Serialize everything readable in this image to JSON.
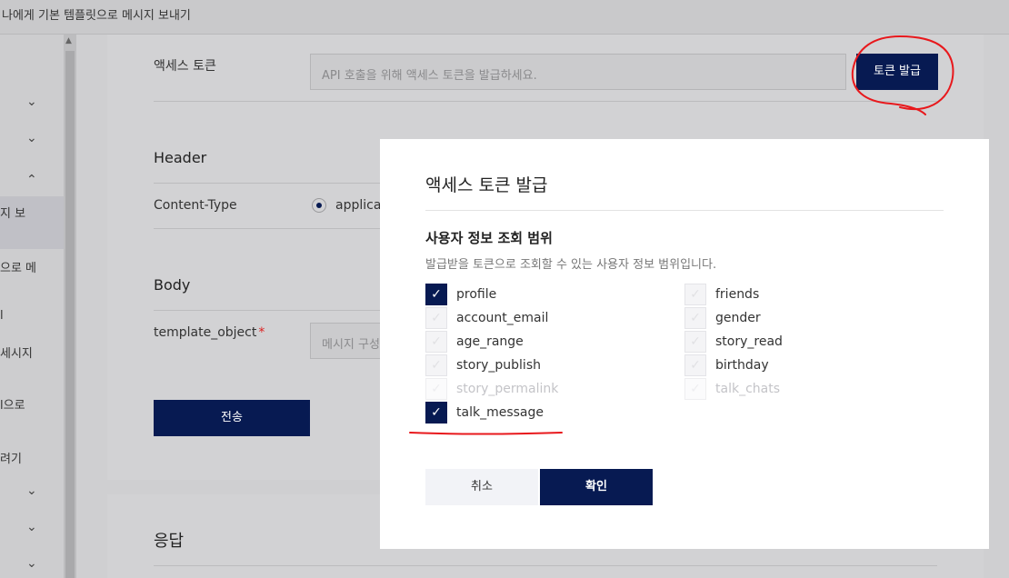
{
  "topbar": {
    "title": "나에게 기본 템플릿으로 메시지 보내기"
  },
  "sidebar": {
    "items": [
      {
        "label": "지 보"
      },
      {
        "label": "으로 메"
      },
      {
        "label": "l"
      },
      {
        "label": "세시지"
      },
      {
        "label": "l으로"
      },
      {
        "label": "려기"
      }
    ]
  },
  "form": {
    "access_token_label": "액세스 토큰",
    "access_token_placeholder": "API 호출을 위해 액세스 토큰을 발급하세요.",
    "issue_token_button": "토큰 발급",
    "header_section": "Header",
    "content_type_label": "Content-Type",
    "content_type_value": "applicat",
    "body_section": "Body",
    "template_object_label": "template_object",
    "required_mark": "*",
    "template_object_placeholder": "메시지 구성",
    "send_button": "전송",
    "response_section": "응답"
  },
  "modal": {
    "title": "액세스 토큰 발급",
    "scope_title": "사용자 정보 조회 범위",
    "scope_desc": "발급받을 토큰으로 조회할 수 있는 사용자 정보 범위입니다.",
    "scopes_left": [
      {
        "label": "profile",
        "checked": true,
        "disabled": false
      },
      {
        "label": "account_email",
        "checked": false,
        "disabled": false
      },
      {
        "label": "age_range",
        "checked": false,
        "disabled": false
      },
      {
        "label": "story_publish",
        "checked": false,
        "disabled": false
      },
      {
        "label": "story_permalink",
        "checked": false,
        "disabled": true
      },
      {
        "label": "talk_message",
        "checked": true,
        "disabled": false
      }
    ],
    "scopes_right": [
      {
        "label": "friends",
        "checked": false,
        "disabled": false
      },
      {
        "label": "gender",
        "checked": false,
        "disabled": false
      },
      {
        "label": "story_read",
        "checked": false,
        "disabled": false
      },
      {
        "label": "birthday",
        "checked": false,
        "disabled": false
      },
      {
        "label": "talk_chats",
        "checked": false,
        "disabled": true
      }
    ],
    "cancel_button": "취소",
    "confirm_button": "확인"
  },
  "icons": {
    "check": "check-icon",
    "chevron_down": "chevron-down-icon",
    "chevron_up": "chevron-up-icon"
  },
  "colors": {
    "primary": "#071a52",
    "annotation": "#e8181c"
  }
}
